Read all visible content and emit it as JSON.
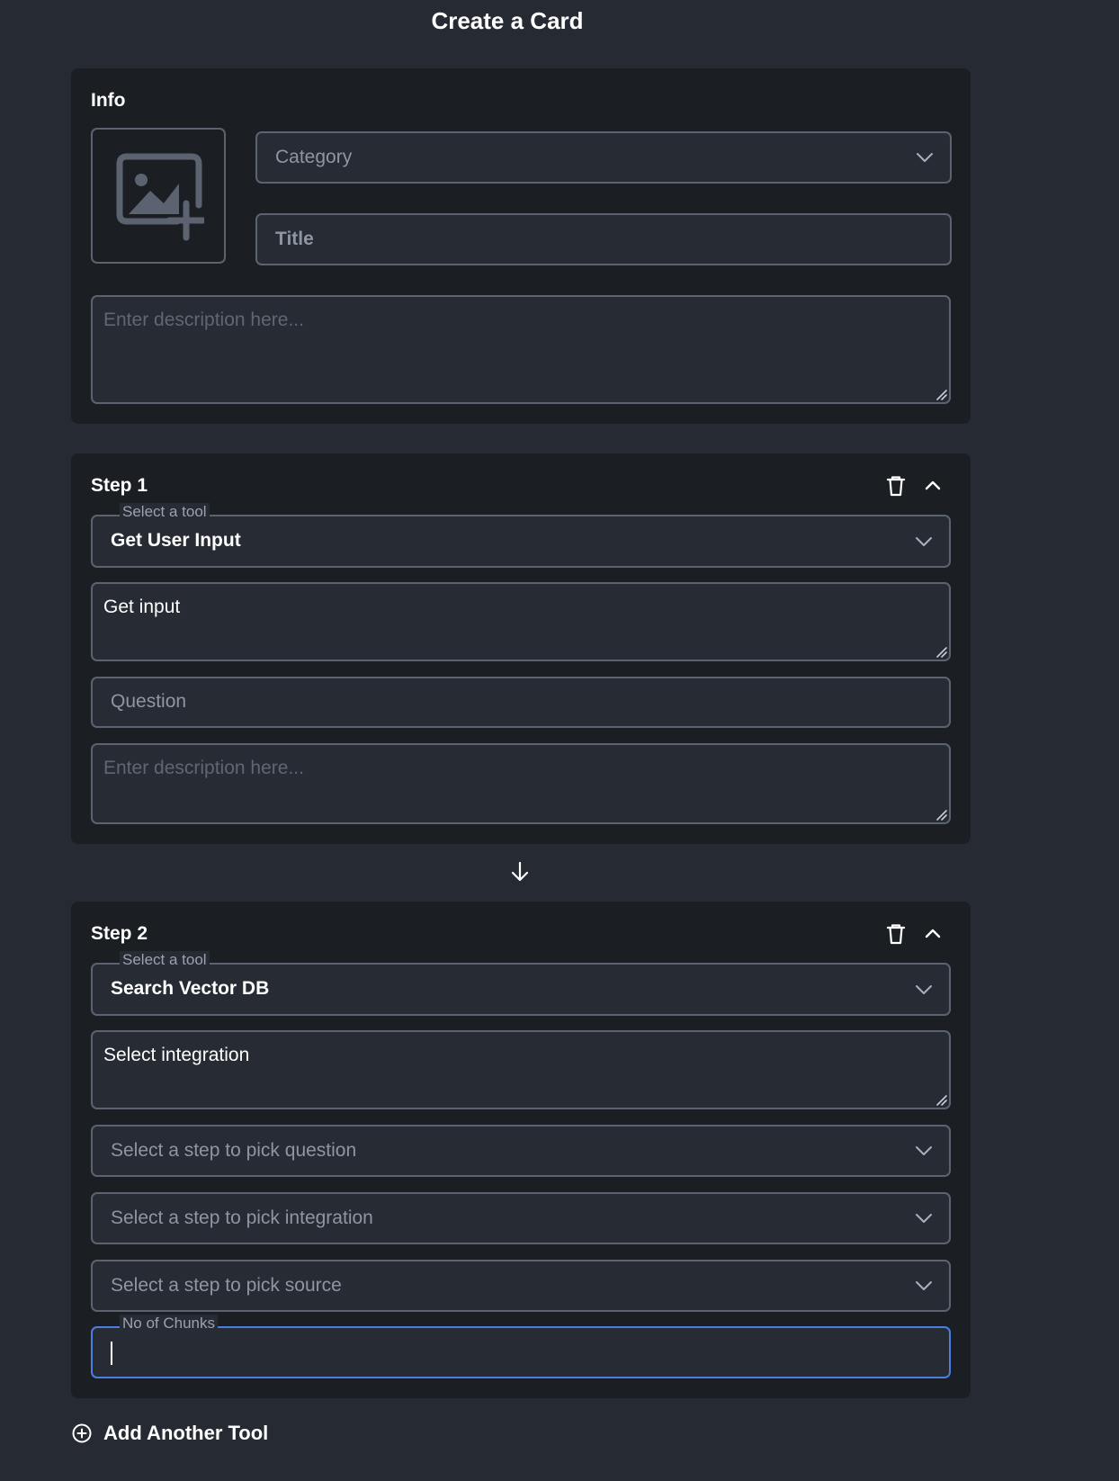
{
  "page": {
    "title": "Create a Card"
  },
  "info": {
    "title": "Info",
    "category_placeholder": "Category",
    "title_placeholder": "Title",
    "description_placeholder": "Enter description here..."
  },
  "steps": [
    {
      "title": "Step 1",
      "tool_legend": "Select a tool",
      "tool_value": "Get User Input",
      "name_value": "Get input",
      "question_placeholder": "Question",
      "description_placeholder": "Enter description here..."
    },
    {
      "title": "Step 2",
      "tool_legend": "Select a tool",
      "tool_value": "Search Vector DB",
      "name_value": "Select integration",
      "pick_question_placeholder": "Select a step to pick question",
      "pick_integration_placeholder": "Select a step to pick integration",
      "pick_source_placeholder": "Select a step to pick source",
      "chunks_legend": "No of Chunks",
      "chunks_value": ""
    }
  ],
  "add_tool": {
    "label": "Add Another Tool",
    "icon": "plus-circle-icon"
  },
  "icons": {
    "image_upload": "image-plus-icon",
    "delete": "trash-icon",
    "collapse": "chevron-up-icon",
    "dropdown": "chevron-down-icon",
    "flow": "arrow-down-icon"
  },
  "colors": {
    "background": "#252a33",
    "panel": "#1b1f24",
    "border": "#5b6370",
    "focus": "#4a7fe0"
  }
}
